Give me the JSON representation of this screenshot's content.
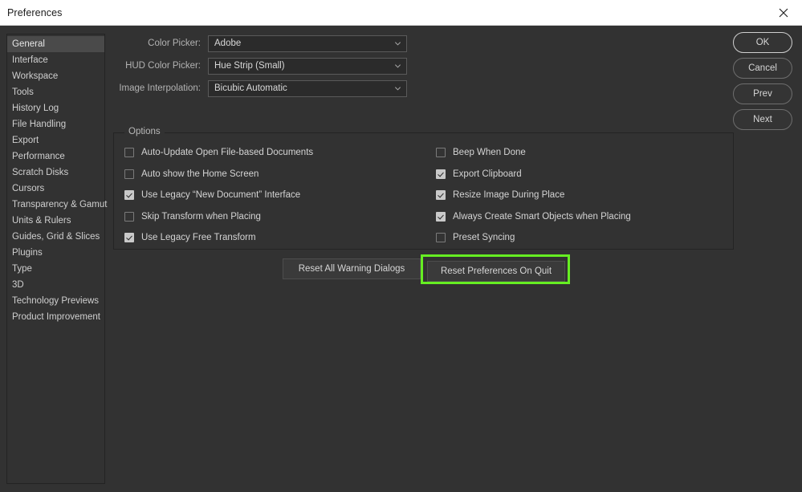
{
  "window": {
    "title": "Preferences",
    "close_icon": "close-icon"
  },
  "sidebar": {
    "items": [
      {
        "label": "General",
        "selected": true
      },
      {
        "label": "Interface",
        "selected": false
      },
      {
        "label": "Workspace",
        "selected": false
      },
      {
        "label": "Tools",
        "selected": false
      },
      {
        "label": "History Log",
        "selected": false
      },
      {
        "label": "File Handling",
        "selected": false
      },
      {
        "label": "Export",
        "selected": false
      },
      {
        "label": "Performance",
        "selected": false
      },
      {
        "label": "Scratch Disks",
        "selected": false
      },
      {
        "label": "Cursors",
        "selected": false
      },
      {
        "label": "Transparency & Gamut",
        "selected": false
      },
      {
        "label": "Units & Rulers",
        "selected": false
      },
      {
        "label": "Guides, Grid & Slices",
        "selected": false
      },
      {
        "label": "Plugins",
        "selected": false
      },
      {
        "label": "Type",
        "selected": false
      },
      {
        "label": "3D",
        "selected": false
      },
      {
        "label": "Technology Previews",
        "selected": false
      },
      {
        "label": "Product Improvement",
        "selected": false
      }
    ]
  },
  "action_buttons": [
    {
      "label": "OK",
      "primary": true
    },
    {
      "label": "Cancel",
      "primary": false
    },
    {
      "label": "Prev",
      "primary": false
    },
    {
      "label": "Next",
      "primary": false
    }
  ],
  "form": {
    "rows": [
      {
        "label": "Color Picker:",
        "value": "Adobe"
      },
      {
        "label": "HUD Color Picker:",
        "value": "Hue Strip (Small)"
      },
      {
        "label": "Image Interpolation:",
        "value": "Bicubic Automatic"
      }
    ]
  },
  "options_group": {
    "legend": "Options",
    "left_column": [
      {
        "label": "Auto-Update Open File-based Documents",
        "checked": false
      },
      {
        "label": "Auto show the Home Screen",
        "checked": false
      },
      {
        "label": "Use Legacy “New Document” Interface",
        "checked": true
      },
      {
        "label": "Skip Transform when Placing",
        "checked": false
      },
      {
        "label": "Use Legacy Free Transform",
        "checked": true
      }
    ],
    "right_column": [
      {
        "label": "Beep When Done",
        "checked": false
      },
      {
        "label": "Export Clipboard",
        "checked": true
      },
      {
        "label": "Resize Image During Place",
        "checked": true
      },
      {
        "label": "Always Create Smart Objects when Placing",
        "checked": true
      },
      {
        "label": "Preset Syncing",
        "checked": false
      }
    ]
  },
  "bottom_buttons": {
    "reset_warnings_label": "Reset All Warning Dialogs",
    "reset_prefs_on_quit_label": "Reset Preferences On Quit"
  },
  "colors": {
    "highlight": "#66ee22",
    "dialog_bg": "#323232",
    "titlebar_bg": "#ffffff",
    "selected_item_bg": "#4a4a4a"
  }
}
